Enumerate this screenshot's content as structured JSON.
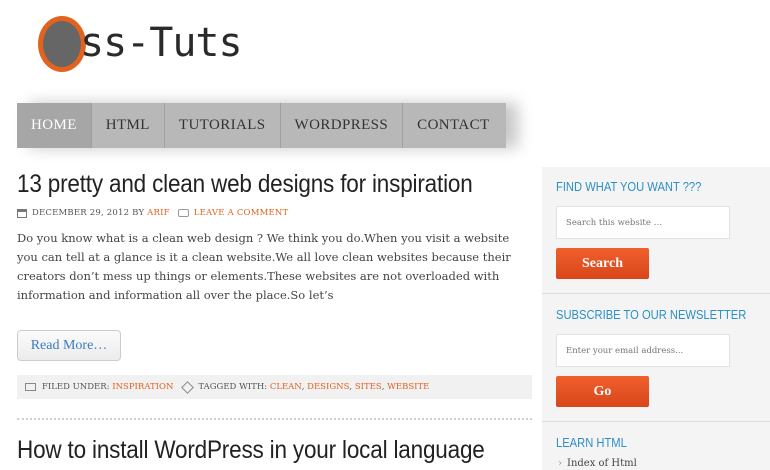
{
  "site": {
    "logo_text": "ss-Tuts"
  },
  "nav": {
    "items": [
      {
        "label": "HOME"
      },
      {
        "label": "HTML"
      },
      {
        "label": "TUTORIALS"
      },
      {
        "label": "WORDPRESS"
      },
      {
        "label": "CONTACT"
      }
    ]
  },
  "posts": [
    {
      "title": "13 pretty and clean web designs for inspiration",
      "date": "DECEMBER 29, 2012",
      "by": "BY",
      "author": "ARIF",
      "comment": "LEAVE A COMMENT",
      "excerpt": "Do you know what is a clean web design ? We think you do.When you visit a website you can tell at a glance is it a clean website.We all love clean websites because their creators don’t mess up things or elements.These websites are not overloaded with information and information all over the place.So let’s",
      "read_more": "Read More…",
      "filed_label": "FILED UNDER:",
      "category": "INSPIRATION",
      "tagged_label": "TAGGED WITH:",
      "tags": [
        "CLEAN",
        "DESIGNS",
        "SITES",
        "WEBSITE"
      ]
    },
    {
      "title": "How to install WordPress in your local language"
    }
  ],
  "sidebar": {
    "search_title": "FIND WHAT YOU WANT ???",
    "search_placeholder": "Search this website …",
    "search_button": "Search",
    "newsletter_title": "SUBSCRIBE TO OUR NEWSLETTER",
    "newsletter_placeholder": "Enter your email address...",
    "newsletter_button": "Go",
    "learn_title": "LEARN HTML",
    "learn_items": [
      {
        "label": "Index of Html"
      }
    ]
  },
  "colors": {
    "accent": "#e2621f",
    "link": "#2e8fc4"
  }
}
